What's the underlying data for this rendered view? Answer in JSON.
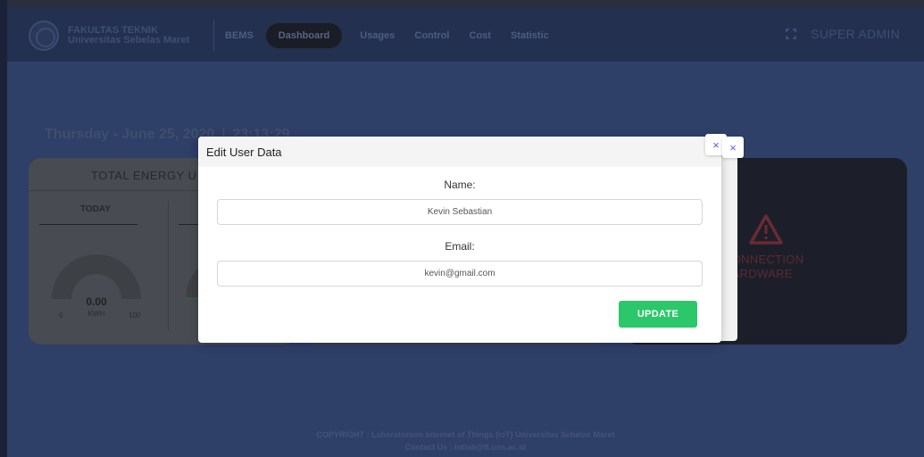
{
  "brand": {
    "line1": "FAKULTAS TEKNIK",
    "line2": "Universitas Sebelas Maret"
  },
  "nav": {
    "items": [
      "BEMS",
      "Dashboard",
      "Usages",
      "Control",
      "Cost",
      "Statistic"
    ],
    "active": "Dashboard"
  },
  "user": {
    "name": "SUPER ADMIN"
  },
  "datetime": {
    "date": "Thursday - June 25, 2020",
    "separator": "|",
    "time": "23:13:29"
  },
  "energy_card": {
    "title": "TOTAL ENERGY U",
    "today_label": "TODAY",
    "gauge": {
      "value": "0.00",
      "unit": "KWH",
      "min": "0",
      "max": "100"
    }
  },
  "status_card": {
    "line1": "CONNECTION",
    "line2": "HARDWARE"
  },
  "modal": {
    "title": "Edit User Data",
    "name_label": "Name:",
    "name_value": "Kevin Sebastian",
    "email_label": "Email:",
    "email_value": "kevin@gmail.com",
    "update_label": "UPDATE",
    "close_symbol": "×"
  },
  "footer": {
    "copyright": "COPYRIGHT : Laboratorium Internet of Things (IoT) Universitas Sebelas Maret",
    "contact": "Contact Us : iotlab@ft.uns.ac.id"
  },
  "colors": {
    "accent_green": "#2cc76a",
    "close_icon": "#6a5bd8",
    "page_bg": "#2e3f68"
  }
}
